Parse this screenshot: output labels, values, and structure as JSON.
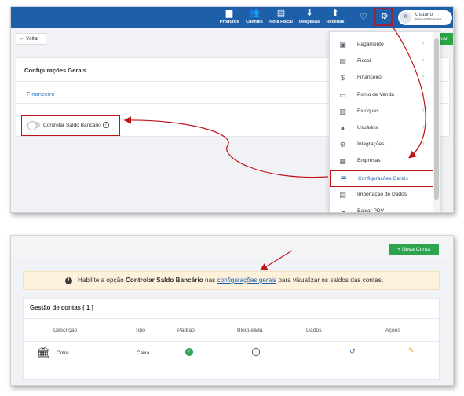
{
  "top_panel": {
    "navbar": {
      "items": [
        {
          "label": "Produtos",
          "icon": "box-icon"
        },
        {
          "label": "Clientes",
          "icon": "users-icon"
        },
        {
          "label": "Nota Fiscal",
          "icon": "invoice-icon"
        },
        {
          "label": "Despesas",
          "icon": "arrow-down-circle-icon"
        },
        {
          "label": "Receitas",
          "icon": "arrow-up-circle-icon"
        }
      ],
      "user": {
        "avatar": "0",
        "name": "Usuário",
        "company": "Minha Empresa"
      }
    },
    "back_label": "← Voltar",
    "save_partial_label": "var",
    "card_title": "Configurações Gerais",
    "section_title": "Financeiro",
    "toggle_label": "Controlar Saldo Bancário",
    "menu": [
      {
        "label": "Pagamento",
        "icon": "money-icon",
        "chevron": "‹"
      },
      {
        "label": "Fiscal",
        "icon": "document-icon",
        "chevron": "‹"
      },
      {
        "label": "Financeiro",
        "icon": "dollar-icon",
        "chevron": "‹"
      },
      {
        "label": "Ponto de Venda",
        "icon": "monitor-icon",
        "chevron": "‹"
      },
      {
        "label": "Estoques",
        "icon": "barcode-icon",
        "chevron": "‹"
      },
      {
        "label": "Usuários",
        "icon": "user-icon",
        "chevron": "‹"
      },
      {
        "label": "Integrações",
        "icon": "cogs-icon",
        "chevron": "‹"
      },
      {
        "label": "Empresas",
        "icon": "building-icon",
        "chevron": ""
      },
      {
        "label": "Configurações Gerais",
        "icon": "sliders-icon",
        "chevron": ""
      },
      {
        "label": "Importação de Dados",
        "icon": "file-import-icon",
        "chevron": ""
      },
      {
        "label": "Baixar PDV",
        "icon": "cloud-download-icon",
        "chevron": ""
      }
    ]
  },
  "bottom_panel": {
    "new_button_label": "+ Nova Conta",
    "alert": {
      "prefix": "Habilite a opção ",
      "bold": "Controlar Saldo Bancário",
      "middle": " nas ",
      "link": "configurações gerais",
      "suffix": " para visualizar os saldos das contas."
    },
    "accounts_title": "Gestão de contas ( 1 )",
    "columns": [
      "Descrição",
      "Tipo",
      "Padrão",
      "Bloqueada",
      "Dados",
      "Ações"
    ],
    "row": {
      "descricao": "Cofre",
      "tipo": "Caixa"
    }
  },
  "colors": {
    "navbar": "#1d5fa8",
    "highlight": "#c0141b",
    "success": "#2ea44f",
    "alert_bg": "#fdf1dc"
  }
}
